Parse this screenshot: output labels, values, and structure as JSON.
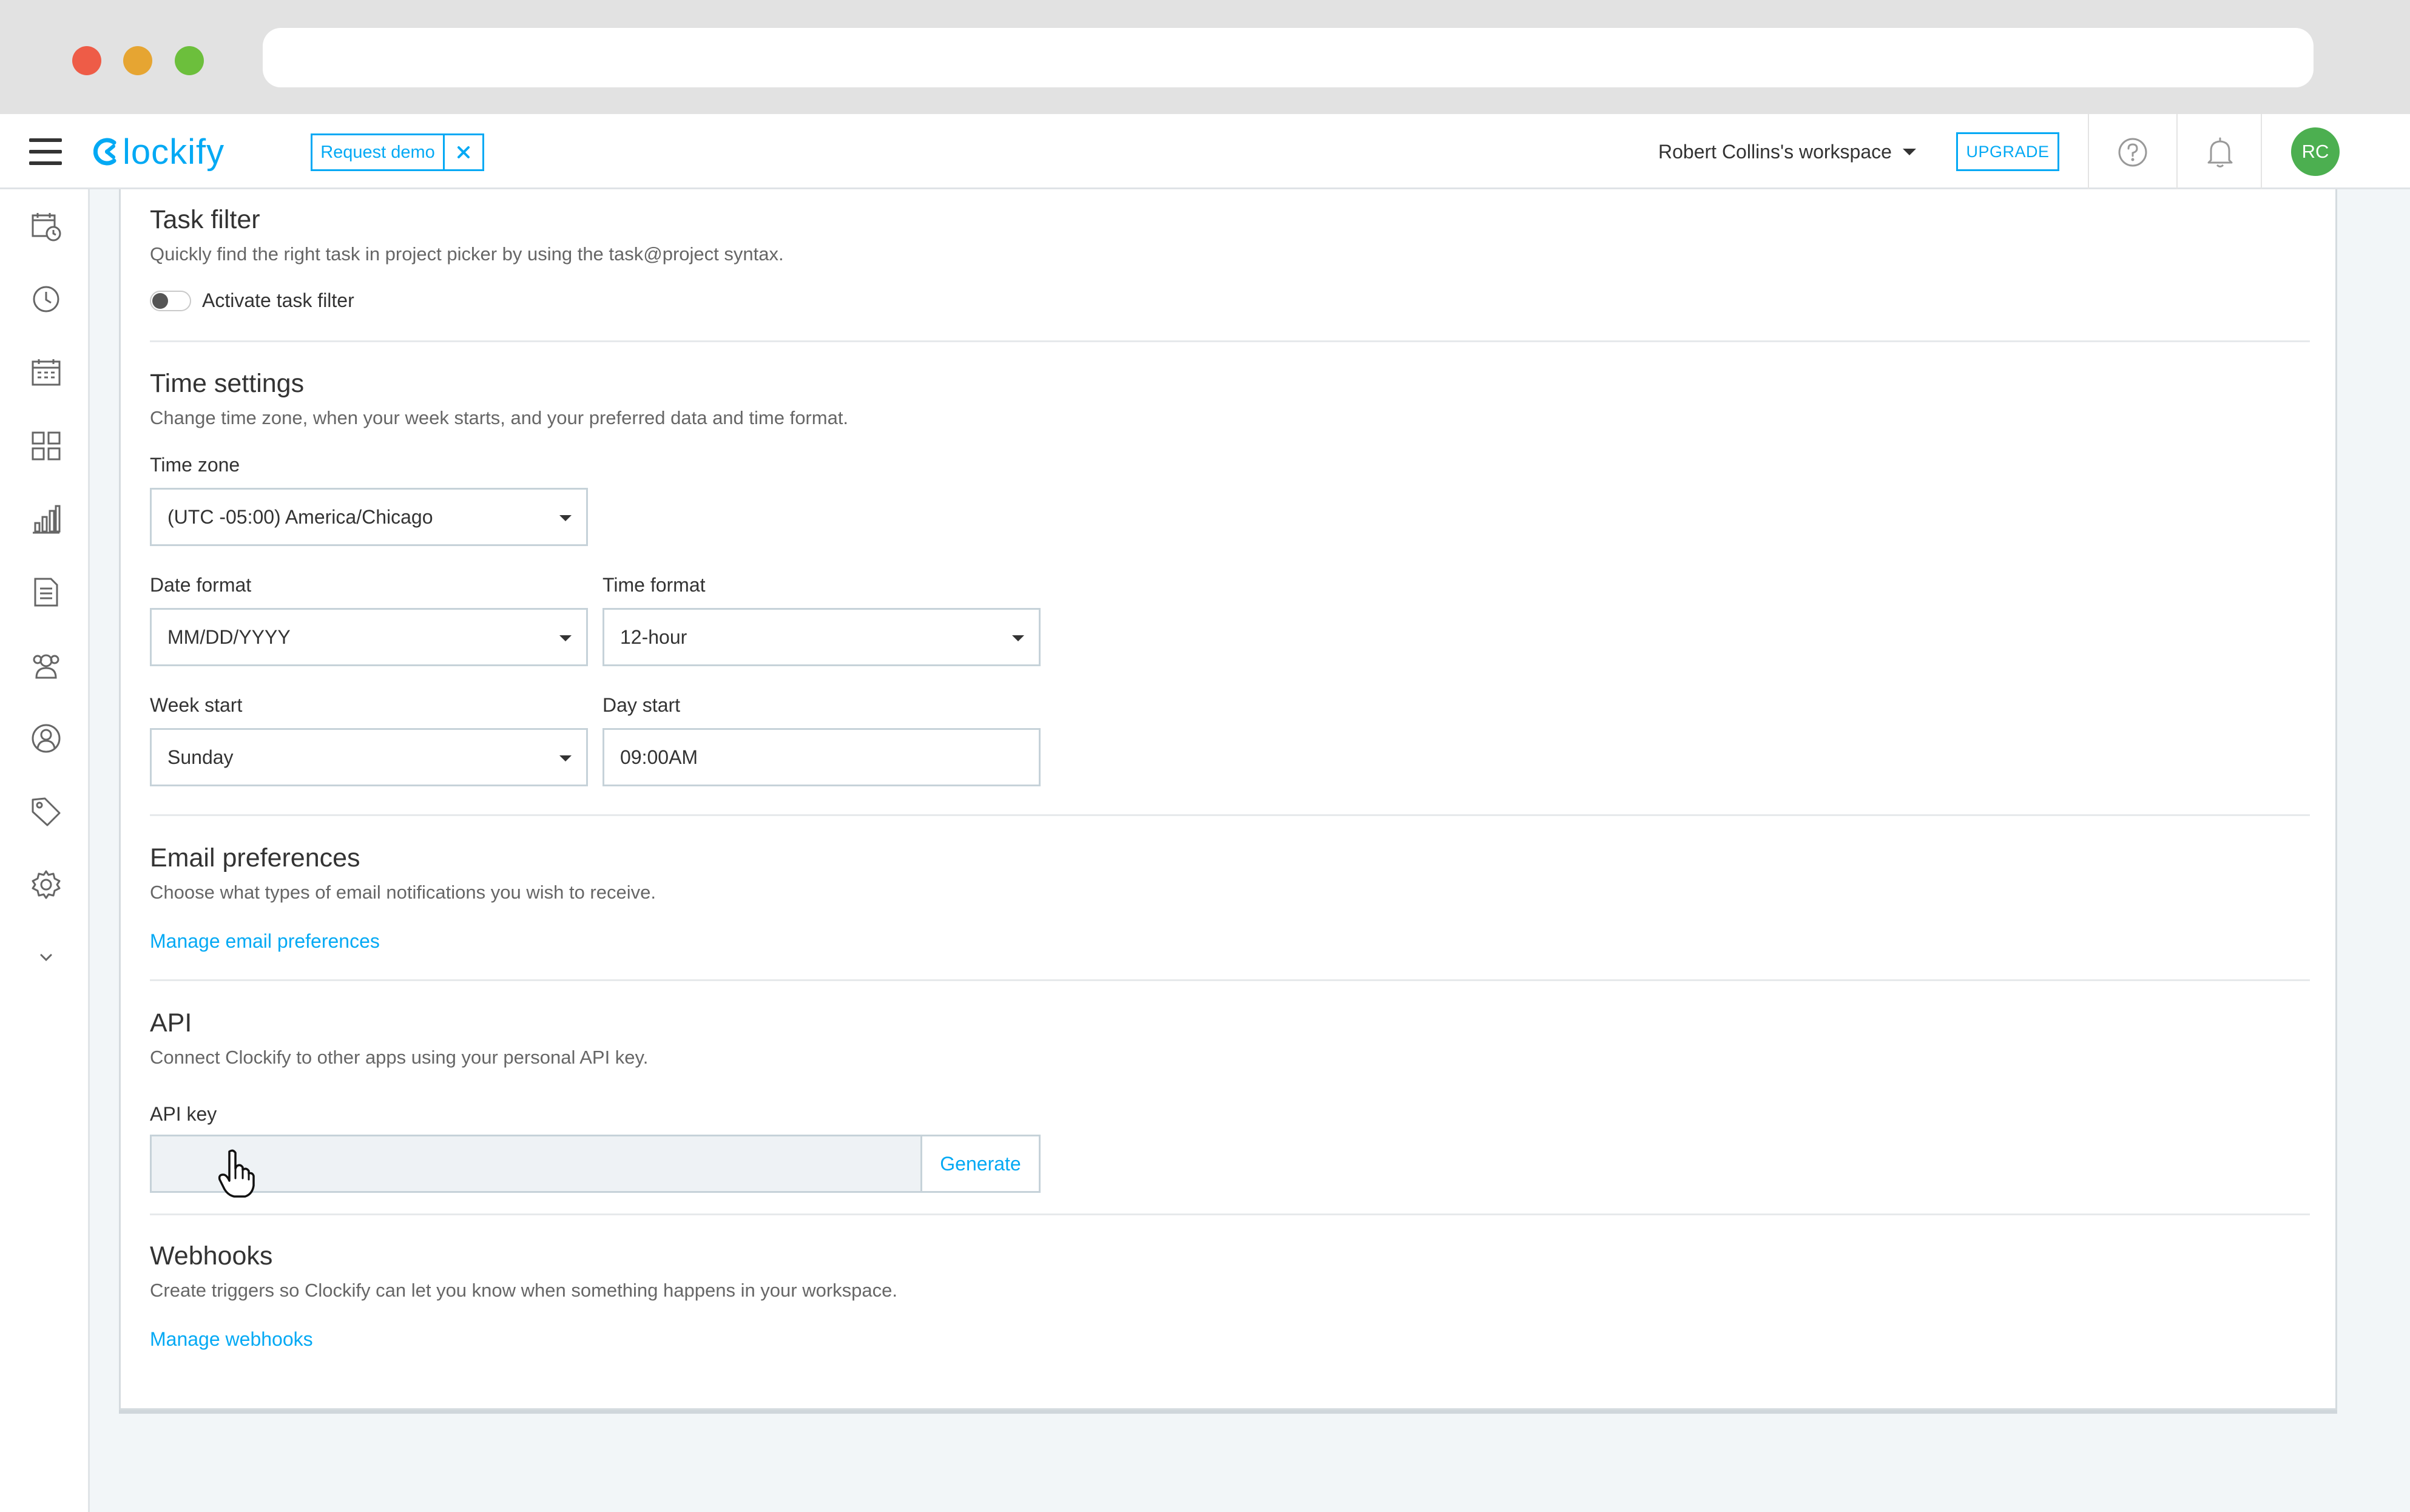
{
  "app": {
    "logo_text": "lockify",
    "request_demo_label": "Request demo",
    "workspace_label": "Robert Collins's workspace",
    "upgrade_label": "UPGRADE",
    "avatar_initials": "RC",
    "brand_color": "#03a9f4",
    "avatar_color": "#4caf50"
  },
  "sidebar": {
    "icons": [
      "calendar-clock-icon",
      "clock-icon",
      "calendar-icon",
      "dashboard-grid-icon",
      "bar-chart-icon",
      "document-icon",
      "team-icon",
      "user-icon",
      "tag-icon",
      "gear-icon",
      "chevron-down-icon"
    ]
  },
  "sections": {
    "task_filter": {
      "title": "Task filter",
      "description": "Quickly find the right task in project picker by using the task@project syntax.",
      "toggle_label": "Activate task filter",
      "toggle_on": false
    },
    "time_settings": {
      "title": "Time settings",
      "description": "Change time zone, when your week starts, and your preferred data and time format.",
      "time_zone_label": "Time zone",
      "time_zone_value": "(UTC -05:00) America/Chicago",
      "date_format_label": "Date format",
      "date_format_value": "MM/DD/YYYY",
      "time_format_label": "Time format",
      "time_format_value": "12-hour",
      "week_start_label": "Week start",
      "week_start_value": "Sunday",
      "day_start_label": "Day start",
      "day_start_value": "09:00AM"
    },
    "email": {
      "title": "Email preferences",
      "description": "Choose what types of email notifications you wish to receive.",
      "link": "Manage email preferences"
    },
    "api": {
      "title": "API",
      "description": "Connect Clockify to other apps using your personal API key.",
      "key_label": "API key",
      "key_value": "",
      "generate_label": "Generate"
    },
    "webhooks": {
      "title": "Webhooks",
      "description": "Create triggers so Clockify can let you know when something happens in your workspace.",
      "link": "Manage webhooks"
    }
  }
}
